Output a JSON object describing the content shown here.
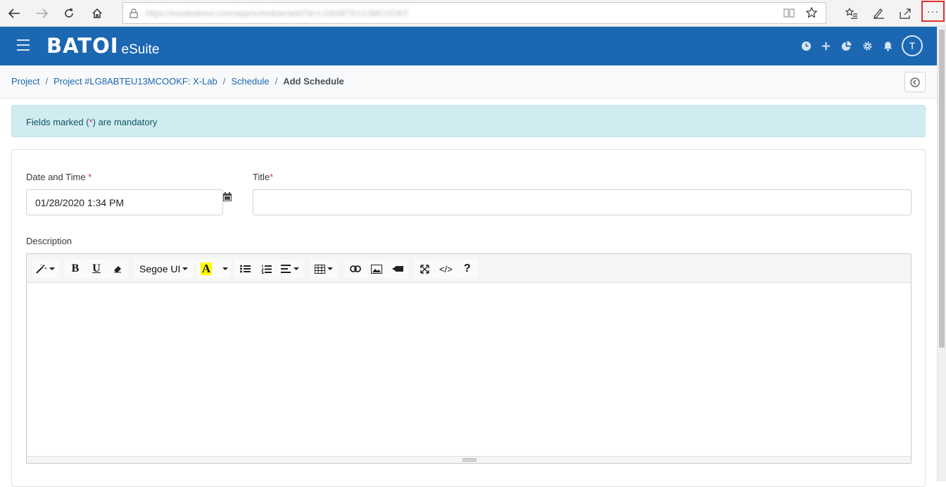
{
  "browser": {
    "url": "https://esuitedemo.com/app/schedule/add?id=LG8ABTEU13MCOOKF",
    "icons": [
      "back-arrow-icon",
      "forward-arrow-icon",
      "refresh-icon",
      "home-icon",
      "lock-icon",
      "reading-view-icon",
      "favorite-star-icon",
      "favorites-list-icon",
      "pen-icon",
      "share-icon",
      "more-dots-icon"
    ],
    "more_label": "···"
  },
  "header": {
    "logo_text": "BATOI",
    "logo_sub": "eSuite",
    "avatar_initial": "T",
    "bg_color": "#1b67b1"
  },
  "breadcrumb": {
    "items": [
      "Project",
      "Project #LG8ABTEU13MCOOKF: X-Lab",
      "Schedule"
    ],
    "separator": "/",
    "active": "Add Schedule"
  },
  "alert": {
    "prefix": "Fields marked (",
    "marker": "*",
    "suffix": ") are mandatory"
  },
  "form": {
    "date_label": "Date and Time",
    "date_required": "*",
    "date_value": "01/28/2020 1:34 PM",
    "title_label": "Title",
    "title_required": "*",
    "title_value": "",
    "description_label": "Description"
  },
  "editor": {
    "font_name": "Segoe UI",
    "bold": "B",
    "underline": "U",
    "highlight": "A",
    "code": "</>",
    "help": "?"
  }
}
